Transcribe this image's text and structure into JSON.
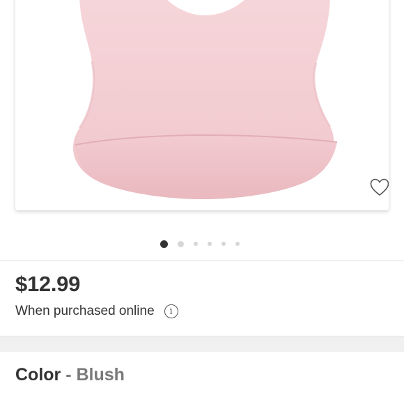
{
  "product": {
    "image_alt": "Silicone baby bib",
    "bib_color": "#f3cfd3",
    "price": "$12.99",
    "purchase_note": "When purchased online",
    "info_icon": "info-icon",
    "favorite_icon": "heart-outline-icon"
  },
  "carousel": {
    "active_index": 0,
    "total": 6
  },
  "variant": {
    "label": "Color",
    "separator": " - ",
    "value": "Blush"
  }
}
